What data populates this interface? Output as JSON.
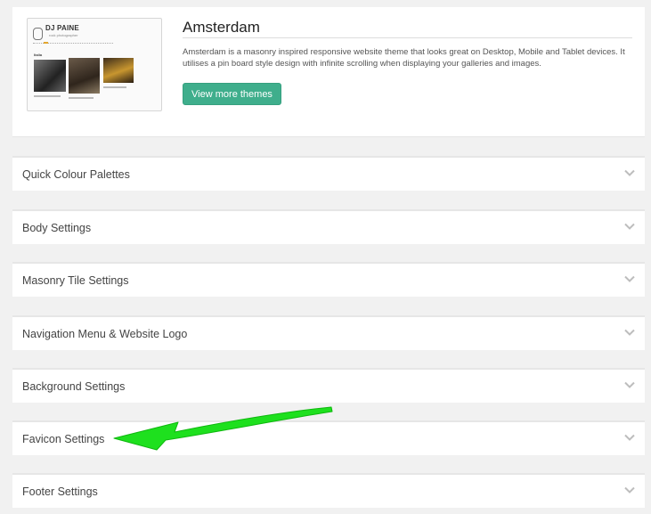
{
  "theme": {
    "name": "Amsterdam",
    "description": "Amsterdam is a masonry inspired responsive website theme that looks great on Desktop, Mobile and Tablet devices. It utilises a pin board style design with infinite scrolling when displaying your galleries and images.",
    "button_label": "View more themes",
    "button_color": "#3fae8c",
    "thumbnail": {
      "logo_text": "DJ PAINE",
      "tagline": "rock photographer",
      "section_label": "Italia"
    }
  },
  "sections": [
    {
      "label": "Quick Colour Palettes"
    },
    {
      "label": "Body Settings"
    },
    {
      "label": "Masonry Tile Settings"
    },
    {
      "label": "Navigation Menu & Website Logo"
    },
    {
      "label": "Background Settings"
    },
    {
      "label": "Favicon Settings"
    },
    {
      "label": "Footer Settings"
    }
  ],
  "annotation": {
    "arrow_color": "#1ee01e",
    "points_to": "Favicon Settings"
  }
}
